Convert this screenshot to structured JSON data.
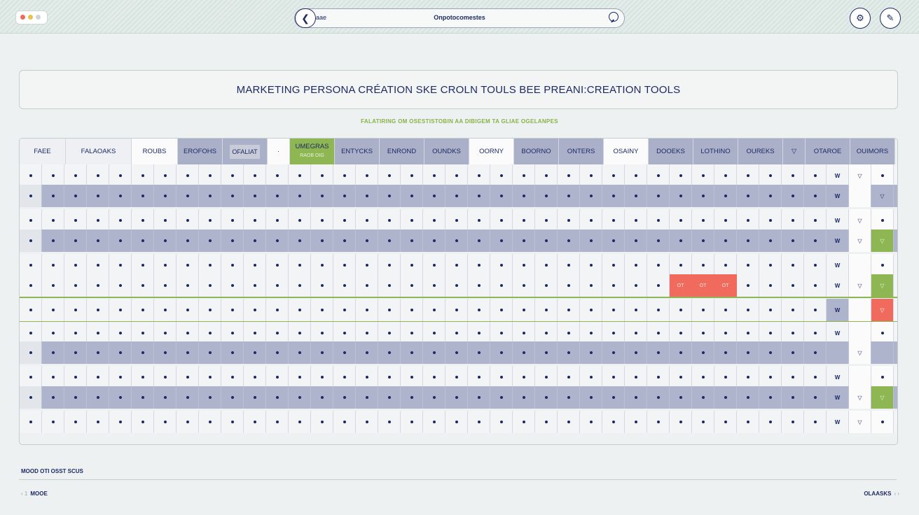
{
  "browser": {
    "url_prefix": "aae",
    "address": "Onpotocomestes",
    "back_glyph": "❮",
    "btn1_glyph": "⚙",
    "btn2_glyph": "✎"
  },
  "page": {
    "title": "MARKETING PERSONA CRÉATION SKE CROLN TOULS BEE PREANI:CREATION TOOLS",
    "subtitle": "FALATIRING OM OSESTISTOBIN AA DIBIGEM TA GLIAE OGELANPES"
  },
  "table": {
    "headers": [
      "FAEE",
      "FALAOAKS",
      "ROUBS",
      "EROFOHS",
      "OFALIAT",
      "·",
      "UMEGRAS",
      "ENTYCKS",
      "ENROND",
      "OUNDKS",
      "OORNY",
      "BOORNO",
      "ONTERS",
      "OSAINY",
      "DOOEKS",
      "LOTHINO",
      "OUREKS",
      "▽",
      "OTAROE",
      "OUIMORS"
    ],
    "green_header_sub": "RAOB OIG",
    "w_label": "W",
    "v_label": "▽",
    "red_label": "OT"
  },
  "footer": {
    "section_label": "MOOD OTI OSST SCUS",
    "pager_prefix": "‹ 1",
    "pager_left": "MOOE",
    "pager_right": "OLAASKS",
    "pager_suffix": "‹ ›"
  },
  "colors": {
    "accent_green": "#8eb653",
    "accent_red": "#f06a5d",
    "navy": "#1d2a63",
    "band": "#aeb4cc"
  }
}
